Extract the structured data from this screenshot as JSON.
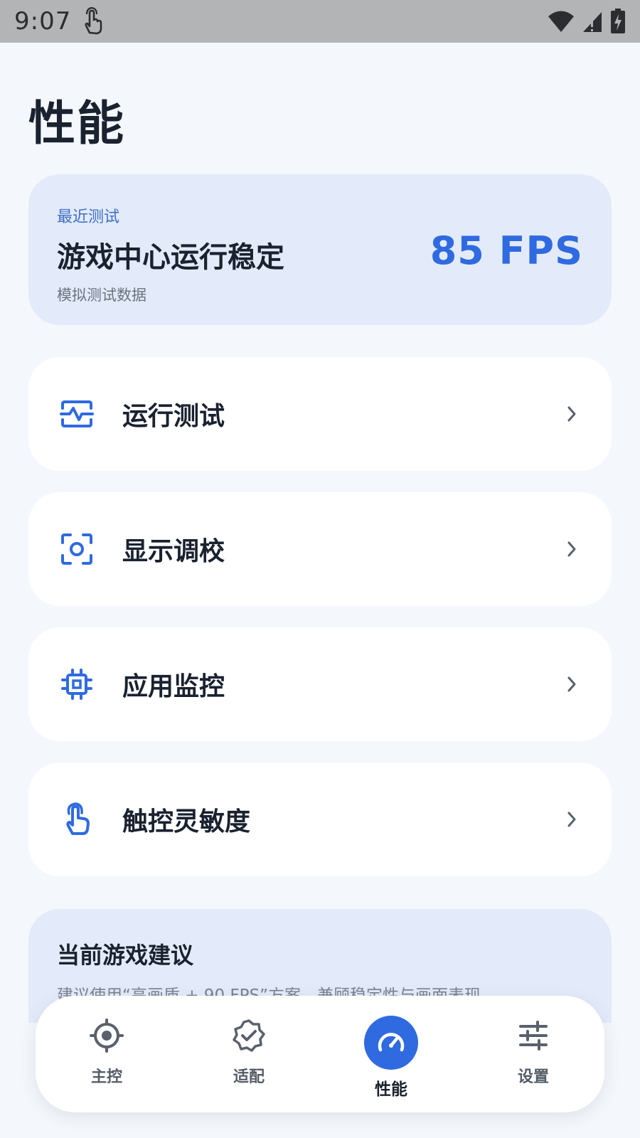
{
  "status_bar": {
    "time": "9:07",
    "icons": [
      "touch-gesture-icon",
      "wifi-icon",
      "cellular-signal-icon",
      "battery-charging-icon"
    ]
  },
  "page": {
    "title": "性能"
  },
  "hero": {
    "eyebrow": "最近测试",
    "headline": "游戏中心运行稳定",
    "note": "模拟测试数据",
    "metric": "85 FPS"
  },
  "menu": [
    {
      "label": "运行测试",
      "icon": "waveform-icon"
    },
    {
      "label": "显示调校",
      "icon": "screen-focus-icon"
    },
    {
      "label": "应用监控",
      "icon": "chip-icon"
    },
    {
      "label": "触控灵敏度",
      "icon": "touch-icon"
    }
  ],
  "advice": {
    "title": "当前游戏建议",
    "text": "建议使用“高画质 + 90 FPS”方案，兼顾稳定性与画面表现。"
  },
  "bottom_nav": [
    {
      "label": "主控",
      "icon": "target-icon",
      "active": false
    },
    {
      "label": "适配",
      "icon": "badge-check-icon",
      "active": false
    },
    {
      "label": "性能",
      "icon": "speedometer-icon",
      "active": true
    },
    {
      "label": "设置",
      "icon": "sliders-icon",
      "active": false
    }
  ],
  "colors": {
    "accent": "#2f6ae0",
    "hero_bg": "#e3ebfa",
    "page_bg": "#f4f7fb",
    "status_bar_bg": "#b3b4b6"
  }
}
